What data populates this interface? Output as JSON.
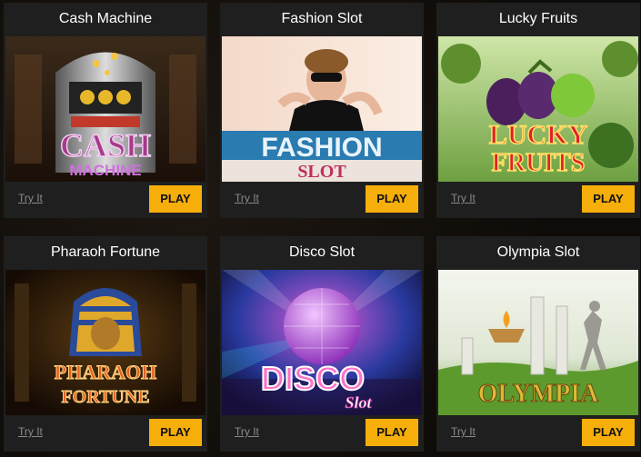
{
  "games": [
    {
      "title": "Cash Machine",
      "logo_line1": "CASH",
      "logo_line2": "MACHINE",
      "try_label": "Try It",
      "play_label": "PLAY"
    },
    {
      "title": "Fashion Slot",
      "logo_line1": "FASHION",
      "logo_line2": "SLOT",
      "try_label": "Try It",
      "play_label": "PLAY"
    },
    {
      "title": "Lucky Fruits",
      "logo_line1": "LUCKY",
      "logo_line2": "FRUITS",
      "try_label": "Try It",
      "play_label": "PLAY"
    },
    {
      "title": "Pharaoh Fortune",
      "logo_line1": "PHARAOH",
      "logo_line2": "FORTUNE",
      "try_label": "Try It",
      "play_label": "PLAY"
    },
    {
      "title": "Disco Slot",
      "logo_line1": "DISCO",
      "logo_line2": "Slot",
      "try_label": "Try It",
      "play_label": "PLAY"
    },
    {
      "title": "Olympia Slot",
      "logo_line1": "OLYMPIA",
      "logo_line2": "",
      "try_label": "Try It",
      "play_label": "PLAY"
    }
  ],
  "colors": {
    "play_button": "#f6ae0b",
    "card_background": "#1f1f1f",
    "page_background": "#120e0a"
  }
}
